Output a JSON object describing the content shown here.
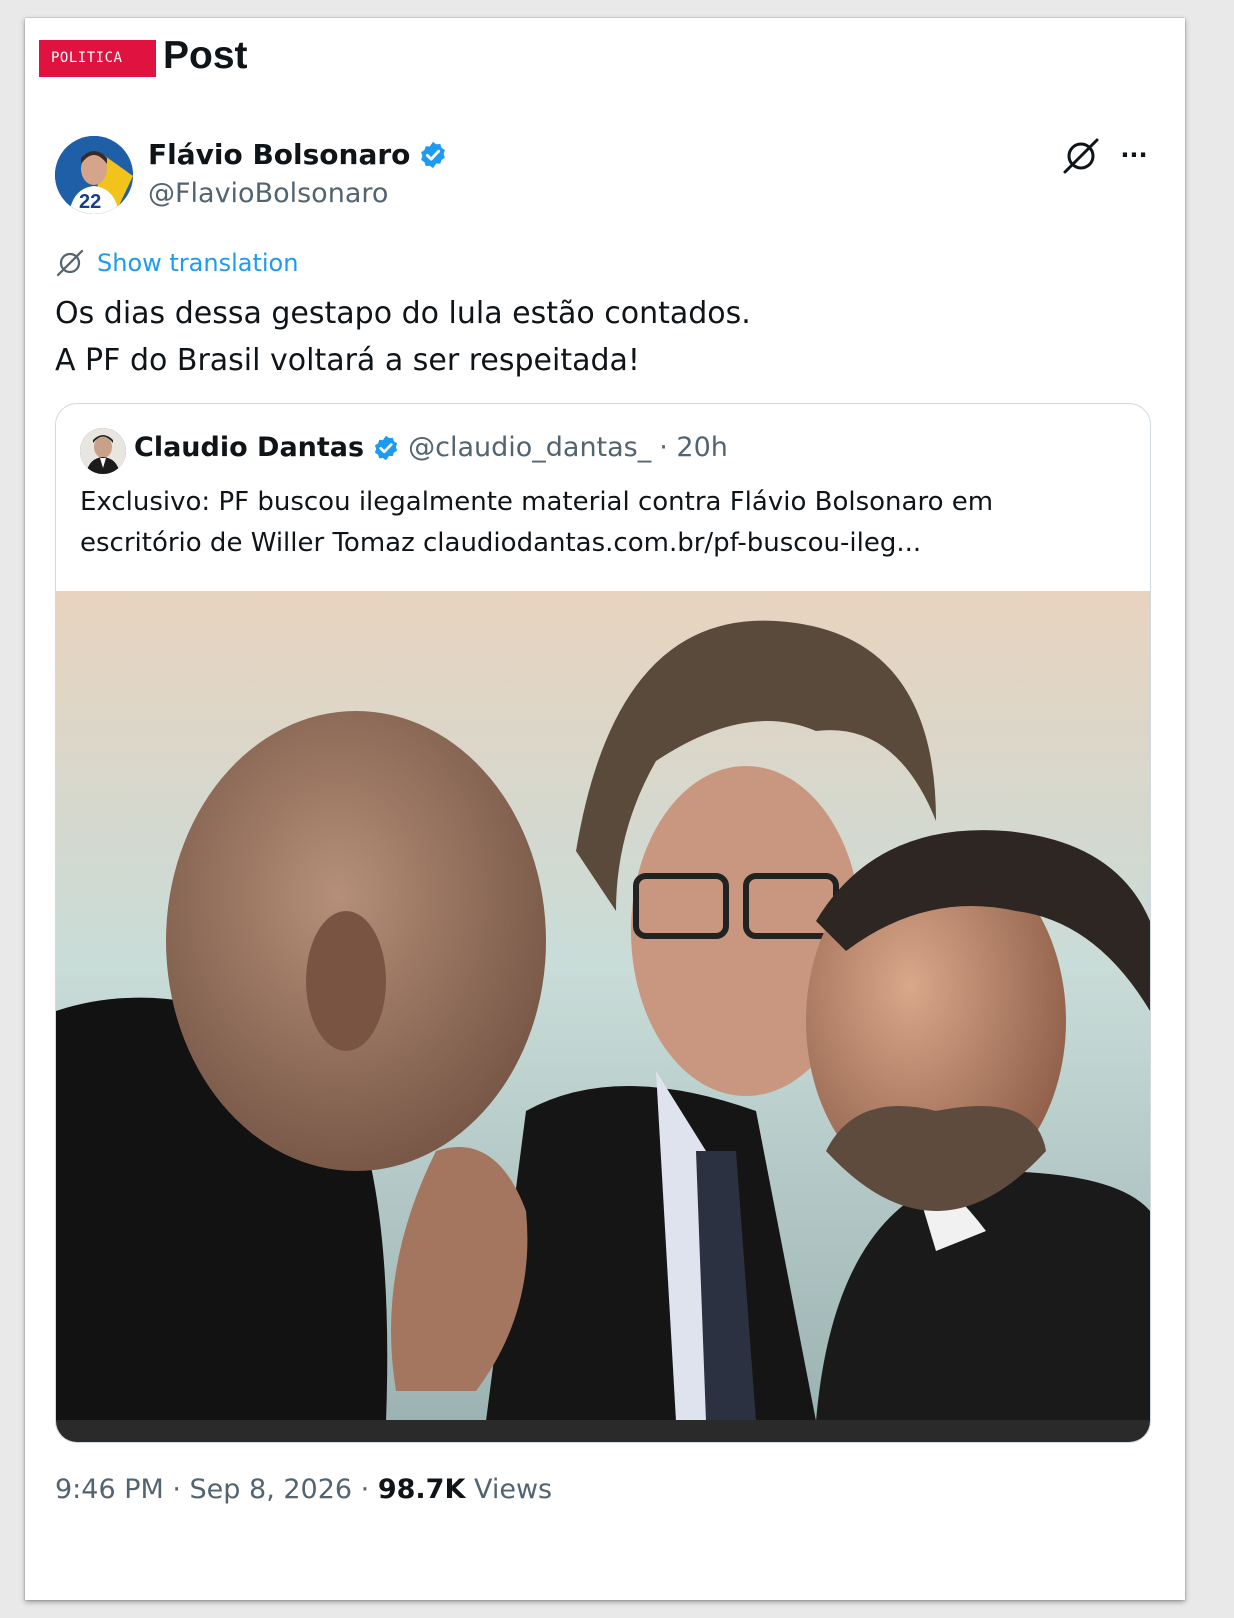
{
  "header": {
    "section_tag": "POLITICA",
    "title": "Post"
  },
  "author": {
    "name": "Flávio Bolsonaro",
    "handle": "@FlavioBolsonaro",
    "verified": true,
    "avatar_number": "22"
  },
  "actions": {
    "grok_icon": "grok-icon",
    "more_icon": "more-icon",
    "more_glyph": "···"
  },
  "translation": {
    "label": "Show translation"
  },
  "tweet": {
    "lines": [
      "Os dias dessa gestapo do lula estão contados.",
      "A PF do Brasil voltará a ser respeitada!"
    ]
  },
  "quote": {
    "name": "Claudio Dantas",
    "handle": "@claudio_dantas_",
    "time": "· 20h",
    "verified": true,
    "lines": [
      "Exclusivo: PF buscou ilegalmente material contra Flávio Bolsonaro em",
      "escritório de Willer Tomaz claudiodantas.com.br/pf-buscou-ileg..."
    ],
    "media_counter": "1"
  },
  "meta": {
    "time": "9:46 PM",
    "separator": " · ",
    "date": "Sep 8, 2026",
    "views_count": "98.7K",
    "views_label": " Views"
  },
  "colors": {
    "link": "#1d9bf0",
    "tag": "#e0123f",
    "verified": "#1d9bf0",
    "secondary_text": "#536471"
  }
}
